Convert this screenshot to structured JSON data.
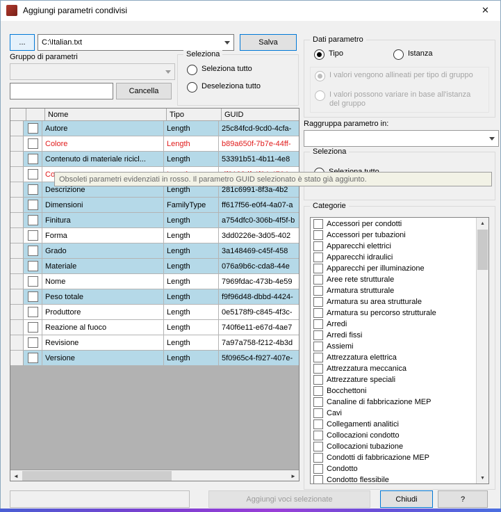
{
  "window": {
    "title": "Aggiungi parametri condivisi",
    "close_glyph": "✕"
  },
  "file_bar": {
    "browse_label": "...",
    "path_value": "C:\\Italian.txt",
    "save_label": "Salva"
  },
  "left_panel": {
    "group_label": "Gruppo di parametri",
    "filter_value": "",
    "cancel_label": "Cancella",
    "select_group": {
      "title": "Seleziona",
      "select_all": "Seleziona tutto",
      "deselect_all": "Deseleziona tutto"
    }
  },
  "table": {
    "columns": [
      "Nome",
      "Tipo",
      "GUID"
    ],
    "rows": [
      {
        "name": "Autore",
        "type": "Length",
        "guid": "25c84fcd-9cd0-4cfa-",
        "added": true,
        "obsolete": false
      },
      {
        "name": "Colore",
        "type": "Length",
        "guid": "b89a650f-7b7e-44ff-",
        "added": false,
        "obsolete": true
      },
      {
        "name": "Contenuto di materiale ricicl...",
        "type": "Length",
        "guid": "53391b51-4b11-4e8",
        "added": true,
        "obsolete": false
      },
      {
        "name": "Costo",
        "type": "Length",
        "guid": "df8182df-4f64-4764-",
        "added": false,
        "obsolete": true
      },
      {
        "name": "Descrizione",
        "type": "Length",
        "guid": "281c6991-8f3a-4b2",
        "added": true,
        "obsolete": false
      },
      {
        "name": "Dimensioni",
        "type": "FamilyType",
        "guid": "ff617f56-e0f4-4a07-a",
        "added": true,
        "obsolete": false
      },
      {
        "name": "Finitura",
        "type": "Length",
        "guid": "a754dfc0-306b-4f5f-b",
        "added": true,
        "obsolete": false
      },
      {
        "name": "Forma",
        "type": "Length",
        "guid": "3dd0226e-3d05-402",
        "added": false,
        "obsolete": false
      },
      {
        "name": "Grado",
        "type": "Length",
        "guid": "3a148469-c45f-458",
        "added": true,
        "obsolete": false
      },
      {
        "name": "Materiale",
        "type": "Length",
        "guid": "076a9b6c-cda8-44e",
        "added": true,
        "obsolete": false
      },
      {
        "name": "Nome",
        "type": "Length",
        "guid": "7969fdac-473b-4e59",
        "added": false,
        "obsolete": false
      },
      {
        "name": "Peso totale",
        "type": "Length",
        "guid": "f9f96d48-dbbd-4424-",
        "added": true,
        "obsolete": false
      },
      {
        "name": "Produttore",
        "type": "Length",
        "guid": "0e5178f9-c845-4f3c-",
        "added": false,
        "obsolete": false
      },
      {
        "name": "Reazione al fuoco",
        "type": "Length",
        "guid": "740f6e11-e67d-4ae7",
        "added": false,
        "obsolete": false
      },
      {
        "name": "Revisione",
        "type": "Length",
        "guid": "7a97a758-f212-4b3d",
        "added": false,
        "obsolete": false
      },
      {
        "name": "Versione",
        "type": "Length",
        "guid": "5f0965c4-f927-407e-",
        "added": true,
        "obsolete": false
      }
    ]
  },
  "tooltip": {
    "text": "Obsoleti parametri evidenziati in rosso. Il parametro GUID selezionato è stato già aggiunto."
  },
  "right_panel": {
    "dati_parametro": {
      "title": "Dati parametro",
      "tipo_label": "Tipo",
      "istanza_label": "Istanza",
      "selected": "Tipo",
      "align_option": "I valori vengono allineati per tipo di gruppo",
      "vary_option": "I valori possono variare in base all'istanza del gruppo"
    },
    "raggruppa_label": "Raggruppa parametro in:",
    "raggruppa_value": "",
    "select_group": {
      "title": "Seleziona",
      "select_all": "Seleziona tutto"
    },
    "categorie": {
      "title": "Categorie",
      "items": [
        "Accessori per condotti",
        "Accessori per tubazioni",
        "Apparecchi elettrici",
        "Apparecchi idraulici",
        "Apparecchi per illuminazione",
        "Aree rete strutturale",
        "Armatura strutturale",
        "Armatura su area strutturale",
        "Armatura su percorso strutturale",
        "Arredi",
        "Arredi fissi",
        "Assiemi",
        "Attrezzatura elettrica",
        "Attrezzatura meccanica",
        "Attrezzature speciali",
        "Bocchettoni",
        "Canaline di fabbricazione MEP",
        "Cavi",
        "Collegamenti analitici",
        "Collocazioni condotto",
        "Collocazioni tubazione",
        "Condotti di fabbricazione MEP",
        "Condotto",
        "Condotto flessibile"
      ]
    }
  },
  "footer": {
    "add_label": "Aggiungi voci selezionate",
    "close_label": "Chiudi",
    "help_label": "?"
  },
  "colors": {
    "added_row": "#b5d9e8",
    "obsolete_text": "#e01b1b",
    "accent": "#0078d7"
  }
}
